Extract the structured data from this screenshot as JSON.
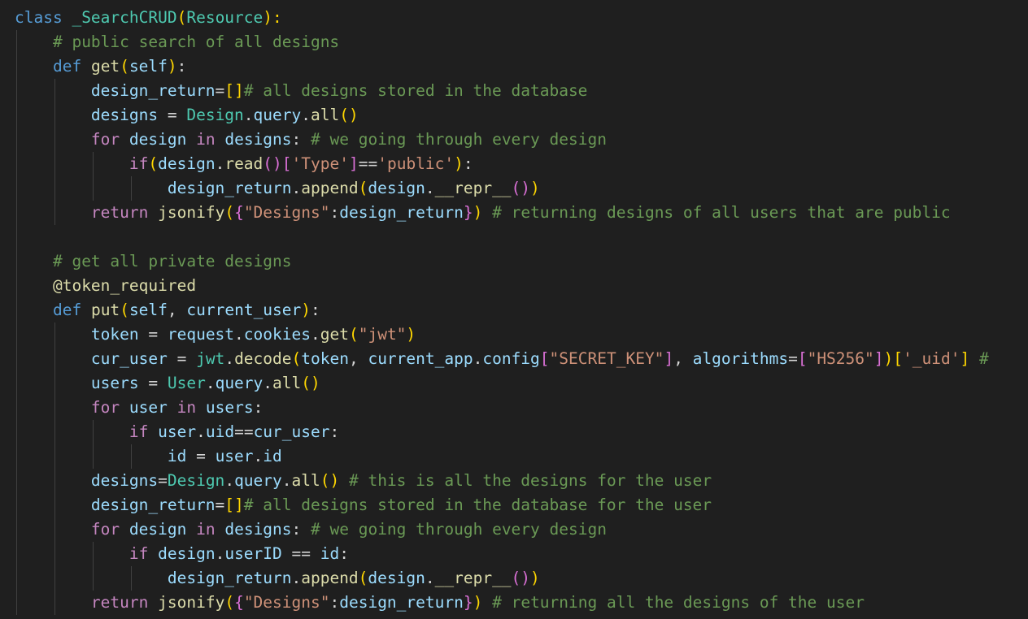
{
  "theme": {
    "background": "#1f1f1f",
    "keyword": "#569cd6",
    "control": "#c586c0",
    "class_name": "#4ec9b0",
    "function": "#dcdcaa",
    "variable": "#9cdcfe",
    "string": "#ce9178",
    "comment": "#6a9955",
    "bracket_1": "#ffd700",
    "bracket_2": "#da70d6",
    "bracket_3": "#179fff",
    "plain": "#d4d4d4",
    "indent_guide": "#404040"
  },
  "code": [
    [
      [
        "class",
        "keyword"
      ],
      [
        " ",
        "plain"
      ],
      [
        "_SearchCRUD",
        "class_name"
      ],
      [
        "(",
        "bracket_1"
      ],
      [
        "Resource",
        "class_name"
      ],
      [
        "):",
        "bracket_1"
      ]
    ],
    [
      [
        "    ",
        "plain"
      ],
      [
        "# public search of all designs",
        "comment"
      ]
    ],
    [
      [
        "    ",
        "plain"
      ],
      [
        "def",
        "keyword"
      ],
      [
        " ",
        "plain"
      ],
      [
        "get",
        "function"
      ],
      [
        "(",
        "bracket_1"
      ],
      [
        "self",
        "variable"
      ],
      [
        ")",
        "bracket_1"
      ],
      [
        ":",
        "plain"
      ]
    ],
    [
      [
        "        ",
        "plain"
      ],
      [
        "design_return",
        "variable"
      ],
      [
        "=",
        "plain"
      ],
      [
        "[]",
        "bracket_1"
      ],
      [
        "# all designs stored in the database",
        "comment"
      ]
    ],
    [
      [
        "        ",
        "plain"
      ],
      [
        "designs",
        "variable"
      ],
      [
        " = ",
        "plain"
      ],
      [
        "Design",
        "class_name"
      ],
      [
        ".",
        "plain"
      ],
      [
        "query",
        "variable"
      ],
      [
        ".",
        "plain"
      ],
      [
        "all",
        "function"
      ],
      [
        "()",
        "bracket_1"
      ]
    ],
    [
      [
        "        ",
        "plain"
      ],
      [
        "for",
        "control"
      ],
      [
        " ",
        "plain"
      ],
      [
        "design",
        "variable"
      ],
      [
        " ",
        "plain"
      ],
      [
        "in",
        "control"
      ],
      [
        " ",
        "plain"
      ],
      [
        "designs",
        "variable"
      ],
      [
        ": ",
        "plain"
      ],
      [
        "# we going through every design",
        "comment"
      ]
    ],
    [
      [
        "            ",
        "plain"
      ],
      [
        "if",
        "control"
      ],
      [
        "(",
        "bracket_1"
      ],
      [
        "design",
        "variable"
      ],
      [
        ".",
        "plain"
      ],
      [
        "read",
        "function"
      ],
      [
        "()",
        "bracket_2"
      ],
      [
        "[",
        "bracket_2"
      ],
      [
        "'Type'",
        "string"
      ],
      [
        "]",
        "bracket_2"
      ],
      [
        "==",
        "plain"
      ],
      [
        "'public'",
        "string"
      ],
      [
        ")",
        "bracket_1"
      ],
      [
        ":",
        "plain"
      ]
    ],
    [
      [
        "                ",
        "plain"
      ],
      [
        "design_return",
        "variable"
      ],
      [
        ".",
        "plain"
      ],
      [
        "append",
        "function"
      ],
      [
        "(",
        "bracket_1"
      ],
      [
        "design",
        "variable"
      ],
      [
        ".",
        "plain"
      ],
      [
        "__repr__",
        "function"
      ],
      [
        "()",
        "bracket_2"
      ],
      [
        ")",
        "bracket_1"
      ]
    ],
    [
      [
        "        ",
        "plain"
      ],
      [
        "return",
        "control"
      ],
      [
        " ",
        "plain"
      ],
      [
        "jsonify",
        "function"
      ],
      [
        "(",
        "bracket_1"
      ],
      [
        "{",
        "bracket_2"
      ],
      [
        "\"Designs\"",
        "string"
      ],
      [
        ":",
        "plain"
      ],
      [
        "design_return",
        "variable"
      ],
      [
        "}",
        "bracket_2"
      ],
      [
        ")",
        "bracket_1"
      ],
      [
        " ",
        "plain"
      ],
      [
        "# returning designs of all users that are public",
        "comment"
      ]
    ],
    [],
    [
      [
        "    ",
        "plain"
      ],
      [
        "# get all private designs",
        "comment"
      ]
    ],
    [
      [
        "    ",
        "plain"
      ],
      [
        "@token_required",
        "function"
      ]
    ],
    [
      [
        "    ",
        "plain"
      ],
      [
        "def",
        "keyword"
      ],
      [
        " ",
        "plain"
      ],
      [
        "put",
        "function"
      ],
      [
        "(",
        "bracket_1"
      ],
      [
        "self",
        "variable"
      ],
      [
        ", ",
        "plain"
      ],
      [
        "current_user",
        "variable"
      ],
      [
        ")",
        "bracket_1"
      ],
      [
        ":",
        "plain"
      ]
    ],
    [
      [
        "        ",
        "plain"
      ],
      [
        "token",
        "variable"
      ],
      [
        " = ",
        "plain"
      ],
      [
        "request",
        "variable"
      ],
      [
        ".",
        "plain"
      ],
      [
        "cookies",
        "variable"
      ],
      [
        ".",
        "plain"
      ],
      [
        "get",
        "function"
      ],
      [
        "(",
        "bracket_1"
      ],
      [
        "\"jwt\"",
        "string"
      ],
      [
        ")",
        "bracket_1"
      ]
    ],
    [
      [
        "        ",
        "plain"
      ],
      [
        "cur_user",
        "variable"
      ],
      [
        " = ",
        "plain"
      ],
      [
        "jwt",
        "class_name"
      ],
      [
        ".",
        "plain"
      ],
      [
        "decode",
        "function"
      ],
      [
        "(",
        "bracket_1"
      ],
      [
        "token",
        "variable"
      ],
      [
        ", ",
        "plain"
      ],
      [
        "current_app",
        "variable"
      ],
      [
        ".",
        "plain"
      ],
      [
        "config",
        "variable"
      ],
      [
        "[",
        "bracket_2"
      ],
      [
        "\"SECRET_KEY\"",
        "string"
      ],
      [
        "]",
        "bracket_2"
      ],
      [
        ", ",
        "plain"
      ],
      [
        "algorithms",
        "variable"
      ],
      [
        "=",
        "plain"
      ],
      [
        "[",
        "bracket_2"
      ],
      [
        "\"HS256\"",
        "string"
      ],
      [
        "]",
        "bracket_2"
      ],
      [
        ")",
        "bracket_1"
      ],
      [
        "[",
        "bracket_1"
      ],
      [
        "'_uid'",
        "string"
      ],
      [
        "]",
        "bracket_1"
      ],
      [
        " #",
        "comment"
      ]
    ],
    [
      [
        "        ",
        "plain"
      ],
      [
        "users",
        "variable"
      ],
      [
        " = ",
        "plain"
      ],
      [
        "User",
        "class_name"
      ],
      [
        ".",
        "plain"
      ],
      [
        "query",
        "variable"
      ],
      [
        ".",
        "plain"
      ],
      [
        "all",
        "function"
      ],
      [
        "()",
        "bracket_1"
      ]
    ],
    [
      [
        "        ",
        "plain"
      ],
      [
        "for",
        "control"
      ],
      [
        " ",
        "plain"
      ],
      [
        "user",
        "variable"
      ],
      [
        " ",
        "plain"
      ],
      [
        "in",
        "control"
      ],
      [
        " ",
        "plain"
      ],
      [
        "users",
        "variable"
      ],
      [
        ":",
        "plain"
      ]
    ],
    [
      [
        "            ",
        "plain"
      ],
      [
        "if",
        "control"
      ],
      [
        " ",
        "plain"
      ],
      [
        "user",
        "variable"
      ],
      [
        ".",
        "plain"
      ],
      [
        "uid",
        "variable"
      ],
      [
        "==",
        "plain"
      ],
      [
        "cur_user",
        "variable"
      ],
      [
        ":",
        "plain"
      ]
    ],
    [
      [
        "                ",
        "plain"
      ],
      [
        "id",
        "variable"
      ],
      [
        " = ",
        "plain"
      ],
      [
        "user",
        "variable"
      ],
      [
        ".",
        "plain"
      ],
      [
        "id",
        "variable"
      ]
    ],
    [
      [
        "        ",
        "plain"
      ],
      [
        "designs",
        "variable"
      ],
      [
        "=",
        "plain"
      ],
      [
        "Design",
        "class_name"
      ],
      [
        ".",
        "plain"
      ],
      [
        "query",
        "variable"
      ],
      [
        ".",
        "plain"
      ],
      [
        "all",
        "function"
      ],
      [
        "()",
        "bracket_1"
      ],
      [
        " ",
        "plain"
      ],
      [
        "# this is all the designs for the user",
        "comment"
      ]
    ],
    [
      [
        "        ",
        "plain"
      ],
      [
        "design_return",
        "variable"
      ],
      [
        "=",
        "plain"
      ],
      [
        "[]",
        "bracket_1"
      ],
      [
        "# all designs stored in the database for the user",
        "comment"
      ]
    ],
    [
      [
        "        ",
        "plain"
      ],
      [
        "for",
        "control"
      ],
      [
        " ",
        "plain"
      ],
      [
        "design",
        "variable"
      ],
      [
        " ",
        "plain"
      ],
      [
        "in",
        "control"
      ],
      [
        " ",
        "plain"
      ],
      [
        "designs",
        "variable"
      ],
      [
        ": ",
        "plain"
      ],
      [
        "# we going through every design",
        "comment"
      ]
    ],
    [
      [
        "            ",
        "plain"
      ],
      [
        "if",
        "control"
      ],
      [
        " ",
        "plain"
      ],
      [
        "design",
        "variable"
      ],
      [
        ".",
        "plain"
      ],
      [
        "userID",
        "variable"
      ],
      [
        " == ",
        "plain"
      ],
      [
        "id",
        "variable"
      ],
      [
        ":",
        "plain"
      ]
    ],
    [
      [
        "                ",
        "plain"
      ],
      [
        "design_return",
        "variable"
      ],
      [
        ".",
        "plain"
      ],
      [
        "append",
        "function"
      ],
      [
        "(",
        "bracket_1"
      ],
      [
        "design",
        "variable"
      ],
      [
        ".",
        "plain"
      ],
      [
        "__repr__",
        "function"
      ],
      [
        "()",
        "bracket_2"
      ],
      [
        ")",
        "bracket_1"
      ]
    ],
    [
      [
        "        ",
        "plain"
      ],
      [
        "return",
        "control"
      ],
      [
        " ",
        "plain"
      ],
      [
        "jsonify",
        "function"
      ],
      [
        "(",
        "bracket_1"
      ],
      [
        "{",
        "bracket_2"
      ],
      [
        "\"Designs\"",
        "string"
      ],
      [
        ":",
        "plain"
      ],
      [
        "design_return",
        "variable"
      ],
      [
        "}",
        "bracket_2"
      ],
      [
        ")",
        "bracket_1"
      ],
      [
        " ",
        "plain"
      ],
      [
        "# returning all the designs of the user",
        "comment"
      ]
    ]
  ]
}
